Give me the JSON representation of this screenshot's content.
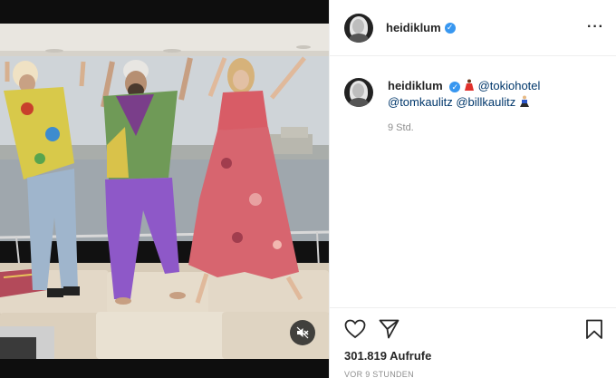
{
  "post": {
    "username": "heidiklum",
    "verified": true,
    "menu_icon": "more-horizontal-icon"
  },
  "caption": {
    "username": "heidiklum",
    "emoji_1": "woman-dancing-emoji",
    "mention_1": "@tokiohotel",
    "mention_2": "@tomkaulitz",
    "mention_3": "@billkaulitz",
    "emoji_2": "man-dancing-emoji",
    "time": "9 Std."
  },
  "media": {
    "type": "video",
    "mute_icon": "speaker-muted-icon"
  },
  "actions": {
    "like_icon": "heart-icon",
    "share_icon": "paper-plane-icon",
    "save_icon": "bookmark-icon",
    "views": "301.819 Aufrufe",
    "timestamp": "VOR 9 STUNDEN"
  },
  "colors": {
    "verified": "#3897f0",
    "link": "#00376b",
    "muted_text": "#8e8e8e",
    "divider": "#efefef"
  }
}
